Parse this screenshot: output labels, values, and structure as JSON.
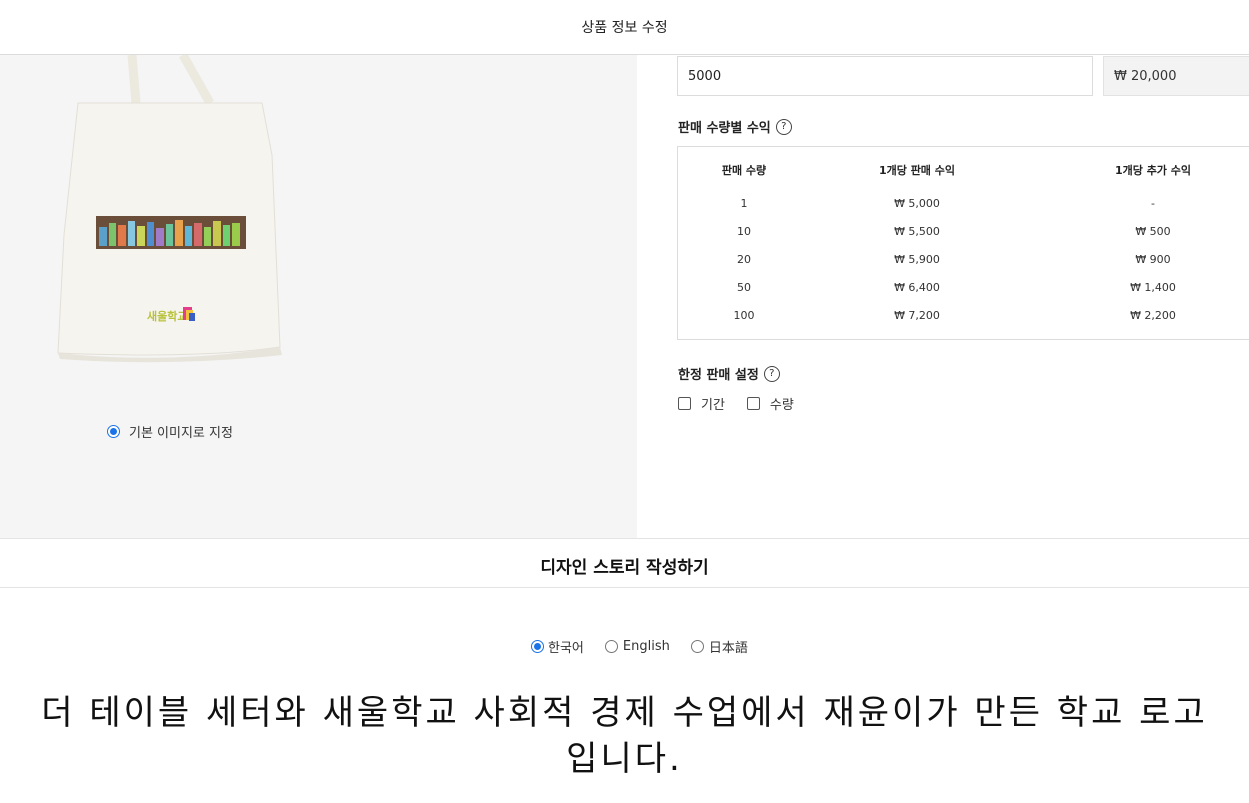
{
  "header": {
    "title": "상품 정보 수정"
  },
  "image_panel": {
    "bag_logo_text": "새울학교",
    "default_image_label": "기본 이미지로 지정"
  },
  "pricing": {
    "quantity_value": "5000",
    "price_value": "₩ 20,000"
  },
  "profit_section": {
    "label": "판매 수량별 수익",
    "help": "?",
    "columns": [
      "판매 수량",
      "1개당 판매 수익",
      "1개당 추가 수익"
    ],
    "rows": [
      [
        "1",
        "₩ 5,000",
        "-"
      ],
      [
        "10",
        "₩ 5,500",
        "₩ 500"
      ],
      [
        "20",
        "₩ 5,900",
        "₩ 900"
      ],
      [
        "50",
        "₩ 6,400",
        "₩ 1,400"
      ],
      [
        "100",
        "₩ 7,200",
        "₩ 2,200"
      ]
    ]
  },
  "limit_section": {
    "label": "한정 판매 설정",
    "help": "?",
    "options": [
      "기간",
      "수량"
    ]
  },
  "story": {
    "header": "디자인 스토리 작성하기",
    "languages": [
      "한국어",
      "English",
      "日本語"
    ],
    "selected_language": "한국어",
    "text": "더 테이블 세터와 새울학교 사회적 경제 수업에서 재윤이가 만든 학교 로고 입니다."
  },
  "colors": {
    "accent": "#1a73e8",
    "panel_bg": "#f5f5f5"
  }
}
